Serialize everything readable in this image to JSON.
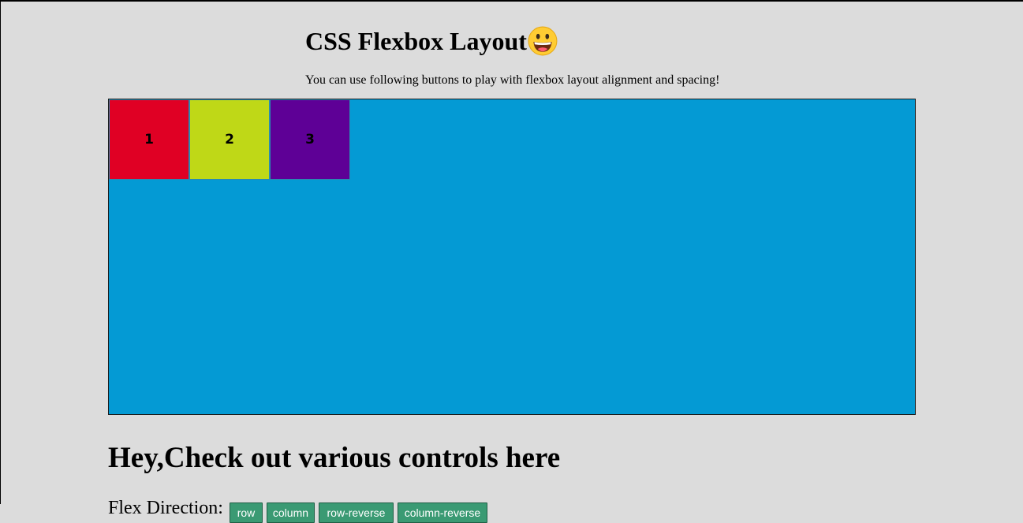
{
  "header": {
    "title": "CSS Flexbox Layout",
    "subtitle": "You can use following buttons to play with flexbox layout alignment and spacing!"
  },
  "flex_container": {
    "background": "#049ad4",
    "items": [
      {
        "label": "1",
        "color": "#e00024"
      },
      {
        "label": "2",
        "color": "#bfd817"
      },
      {
        "label": "3",
        "color": "#5e0096"
      }
    ]
  },
  "controls": {
    "heading": "Hey,Check out various controls here",
    "direction_label": "Flex Direction:",
    "direction_buttons": [
      {
        "label": "row",
        "width": 42
      },
      {
        "label": "column",
        "width": 61
      },
      {
        "label": "row-reverse",
        "width": 95
      },
      {
        "label": "column-reverse",
        "width": 114
      }
    ]
  }
}
